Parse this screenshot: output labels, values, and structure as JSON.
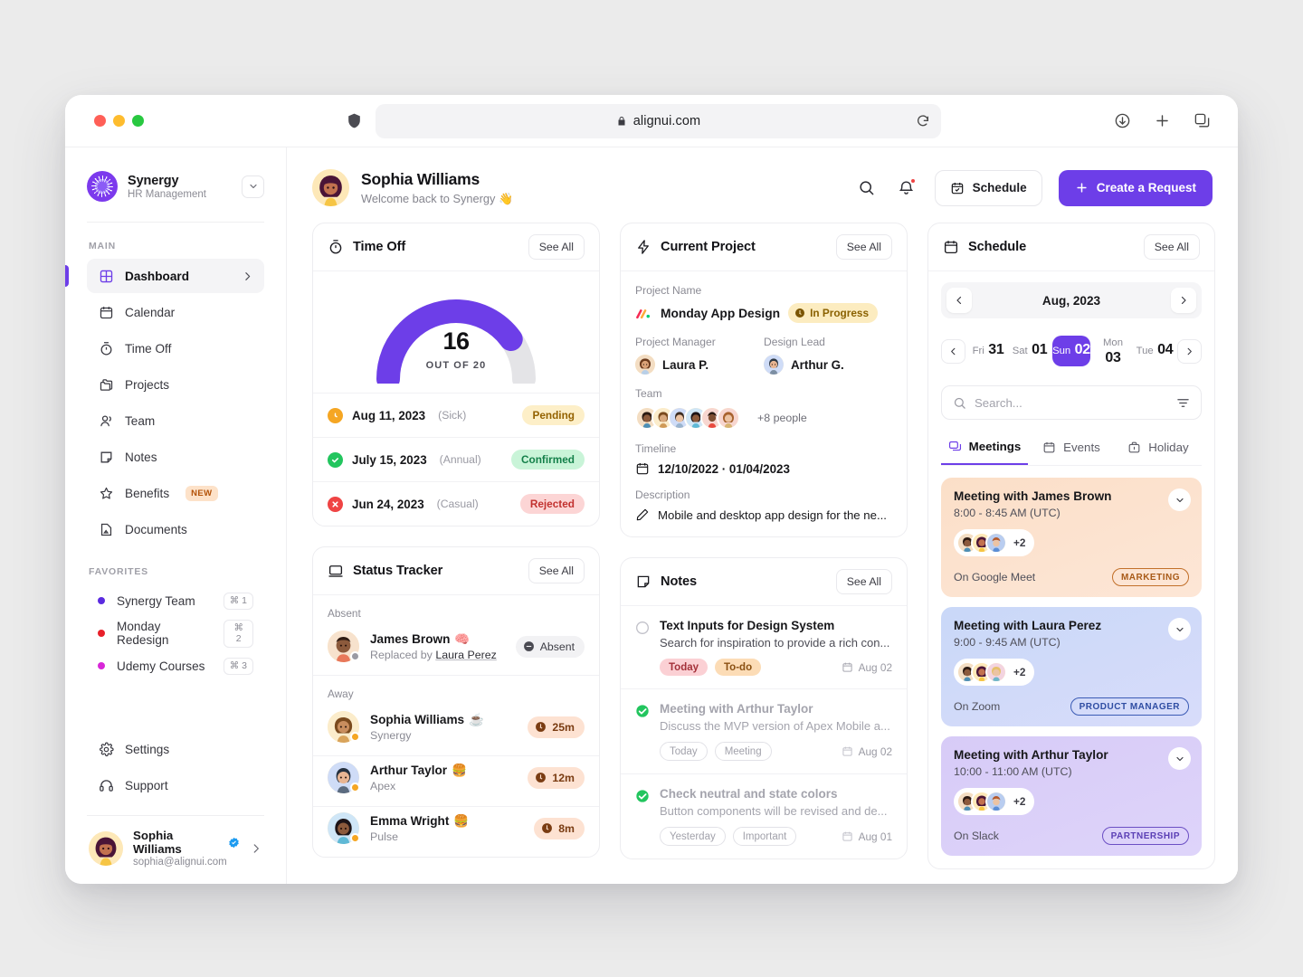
{
  "browser": {
    "url": "alignui.com",
    "icons": [
      "shield-icon",
      "lock-icon",
      "reload-icon",
      "download-icon",
      "new-tab-icon",
      "tabs-icon"
    ]
  },
  "sidebar": {
    "brand": {
      "name": "Synergy",
      "subtitle": "HR Management"
    },
    "main_label": "MAIN",
    "nav": [
      {
        "label": "Dashboard",
        "icon": "grid-icon",
        "active": true
      },
      {
        "label": "Calendar",
        "icon": "calendar-icon",
        "active": false
      },
      {
        "label": "Time Off",
        "icon": "timer-icon",
        "active": false
      },
      {
        "label": "Projects",
        "icon": "folders-icon",
        "active": false
      },
      {
        "label": "Team",
        "icon": "users-icon",
        "active": false
      },
      {
        "label": "Notes",
        "icon": "note-icon",
        "active": false
      },
      {
        "label": "Benefits",
        "icon": "star-icon",
        "active": false,
        "badge": "NEW"
      },
      {
        "label": "Documents",
        "icon": "document-icon",
        "active": false
      }
    ],
    "favorites_label": "FAVORITES",
    "favorites": [
      {
        "label": "Synergy Team",
        "shortcut": "⌘ 1",
        "color": "#5b2be0"
      },
      {
        "label": "Monday Redesign",
        "shortcut": "⌘ 2",
        "color": "#e8202a"
      },
      {
        "label": "Udemy Courses",
        "shortcut": "⌘ 3",
        "color": "#d827d8"
      }
    ],
    "bottom": [
      {
        "label": "Settings",
        "icon": "gear-icon"
      },
      {
        "label": "Support",
        "icon": "headset-icon"
      }
    ],
    "profile": {
      "name": "Sophia Williams",
      "email": "sophia@alignui.com"
    }
  },
  "topbar": {
    "name": "Sophia Williams",
    "welcome": "Welcome back to Synergy 👋",
    "schedule_label": "Schedule",
    "create_label": "Create a Request"
  },
  "time_off": {
    "title": "Time Off",
    "see_all": "See All",
    "gauge": {
      "value": "16",
      "caption": "OUT OF 20",
      "used": 16,
      "total": 20,
      "percent": 80,
      "color": "#6d3ee8",
      "track": "#e4e4e7"
    },
    "rows": [
      {
        "date": "Aug 11, 2023",
        "type": "(Sick)",
        "status": "Pending",
        "state": "pending"
      },
      {
        "date": "July 15, 2023",
        "type": "(Annual)",
        "status": "Confirmed",
        "state": "confirmed"
      },
      {
        "date": "Jun 24, 2023",
        "type": "(Casual)",
        "status": "Rejected",
        "state": "rejected"
      }
    ]
  },
  "status_tracker": {
    "title": "Status Tracker",
    "see_all": "See All",
    "groups": [
      {
        "label": "Absent",
        "rows": [
          {
            "name": "James Brown",
            "emoji": "🧠",
            "sub_prefix": "Replaced by ",
            "sub_link": "Laura Perez",
            "chip": "Absent",
            "chip_type": "absent"
          }
        ]
      },
      {
        "label": "Away",
        "rows": [
          {
            "name": "Sophia Williams",
            "emoji": "☕",
            "sub": "Synergy",
            "chip": "25m",
            "chip_type": "time"
          },
          {
            "name": "Arthur Taylor",
            "emoji": "🍔",
            "sub": "Apex",
            "chip": "12m",
            "chip_type": "time"
          },
          {
            "name": "Emma Wright",
            "emoji": "🍔",
            "sub": "Pulse",
            "chip": "8m",
            "chip_type": "time"
          }
        ]
      }
    ]
  },
  "current_project": {
    "title": "Current Project",
    "see_all": "See All",
    "project_name_label": "Project Name",
    "project_name": "Monday App Design",
    "status": "In Progress",
    "manager_label": "Project Manager",
    "manager": "Laura P.",
    "design_lead_label": "Design Lead",
    "design_lead": "Arthur G.",
    "team_label": "Team",
    "team_more": "+8 people",
    "timeline_label": "Timeline",
    "timeline": "12/10/2022 · 01/04/2023",
    "description_label": "Description",
    "description": "Mobile and desktop app design for the ne..."
  },
  "notes": {
    "title": "Notes",
    "see_all": "See All",
    "items": [
      {
        "title": "Text Inputs for Design System",
        "desc": "Search for inspiration to provide a rich con...",
        "tags": [
          {
            "label": "Today",
            "style": "today"
          },
          {
            "label": "To-do",
            "style": "todo"
          }
        ],
        "date": "Aug 02",
        "done": false
      },
      {
        "title": "Meeting with Arthur Taylor",
        "desc": "Discuss the MVP version of Apex Mobile a...",
        "tags": [
          {
            "label": "Today",
            "style": "ghost"
          },
          {
            "label": "Meeting",
            "style": "ghost"
          }
        ],
        "date": "Aug 02",
        "done": true
      },
      {
        "title": "Check neutral and state colors",
        "desc": "Button components will be revised and de...",
        "tags": [
          {
            "label": "Yesterday",
            "style": "ghost"
          },
          {
            "label": "Important",
            "style": "ghost"
          }
        ],
        "date": "Aug 01",
        "done": true
      }
    ]
  },
  "schedule": {
    "title": "Schedule",
    "see_all": "See All",
    "month": "Aug, 2023",
    "days": [
      {
        "name": "Fri",
        "num": "31",
        "selected": false
      },
      {
        "name": "Sat",
        "num": "01",
        "selected": false
      },
      {
        "name": "Sun",
        "num": "02",
        "selected": true
      },
      {
        "name": "Mon",
        "num": "03",
        "selected": false
      },
      {
        "name": "Tue",
        "num": "04",
        "selected": false
      }
    ],
    "search_placeholder": "Search...",
    "search_value": "",
    "tabs": [
      {
        "label": "Meetings",
        "icon": "chat-icon",
        "active": true
      },
      {
        "label": "Events",
        "icon": "calendar-icon",
        "active": false
      },
      {
        "label": "Holiday",
        "icon": "briefcase-icon",
        "active": false
      }
    ],
    "meetings": [
      {
        "title": "Meeting with James Brown",
        "time": "8:00 - 8:45 AM (UTC)",
        "more": "+2",
        "platform": "On Google Meet",
        "tag": "MARKETING",
        "tag_style": "marketing",
        "card_style": "m1"
      },
      {
        "title": "Meeting with Laura Perez",
        "time": "9:00 - 9:45 AM (UTC)",
        "more": "+2",
        "platform": "On Zoom",
        "tag": "PRODUCT MANAGER",
        "tag_style": "pm",
        "card_style": "m2"
      },
      {
        "title": "Meeting with Arthur Taylor",
        "time": "10:00 - 11:00 AM (UTC)",
        "more": "+2",
        "platform": "On Slack",
        "tag": "PARTNERSHIP",
        "tag_style": "partnership",
        "card_style": "m3"
      }
    ]
  }
}
